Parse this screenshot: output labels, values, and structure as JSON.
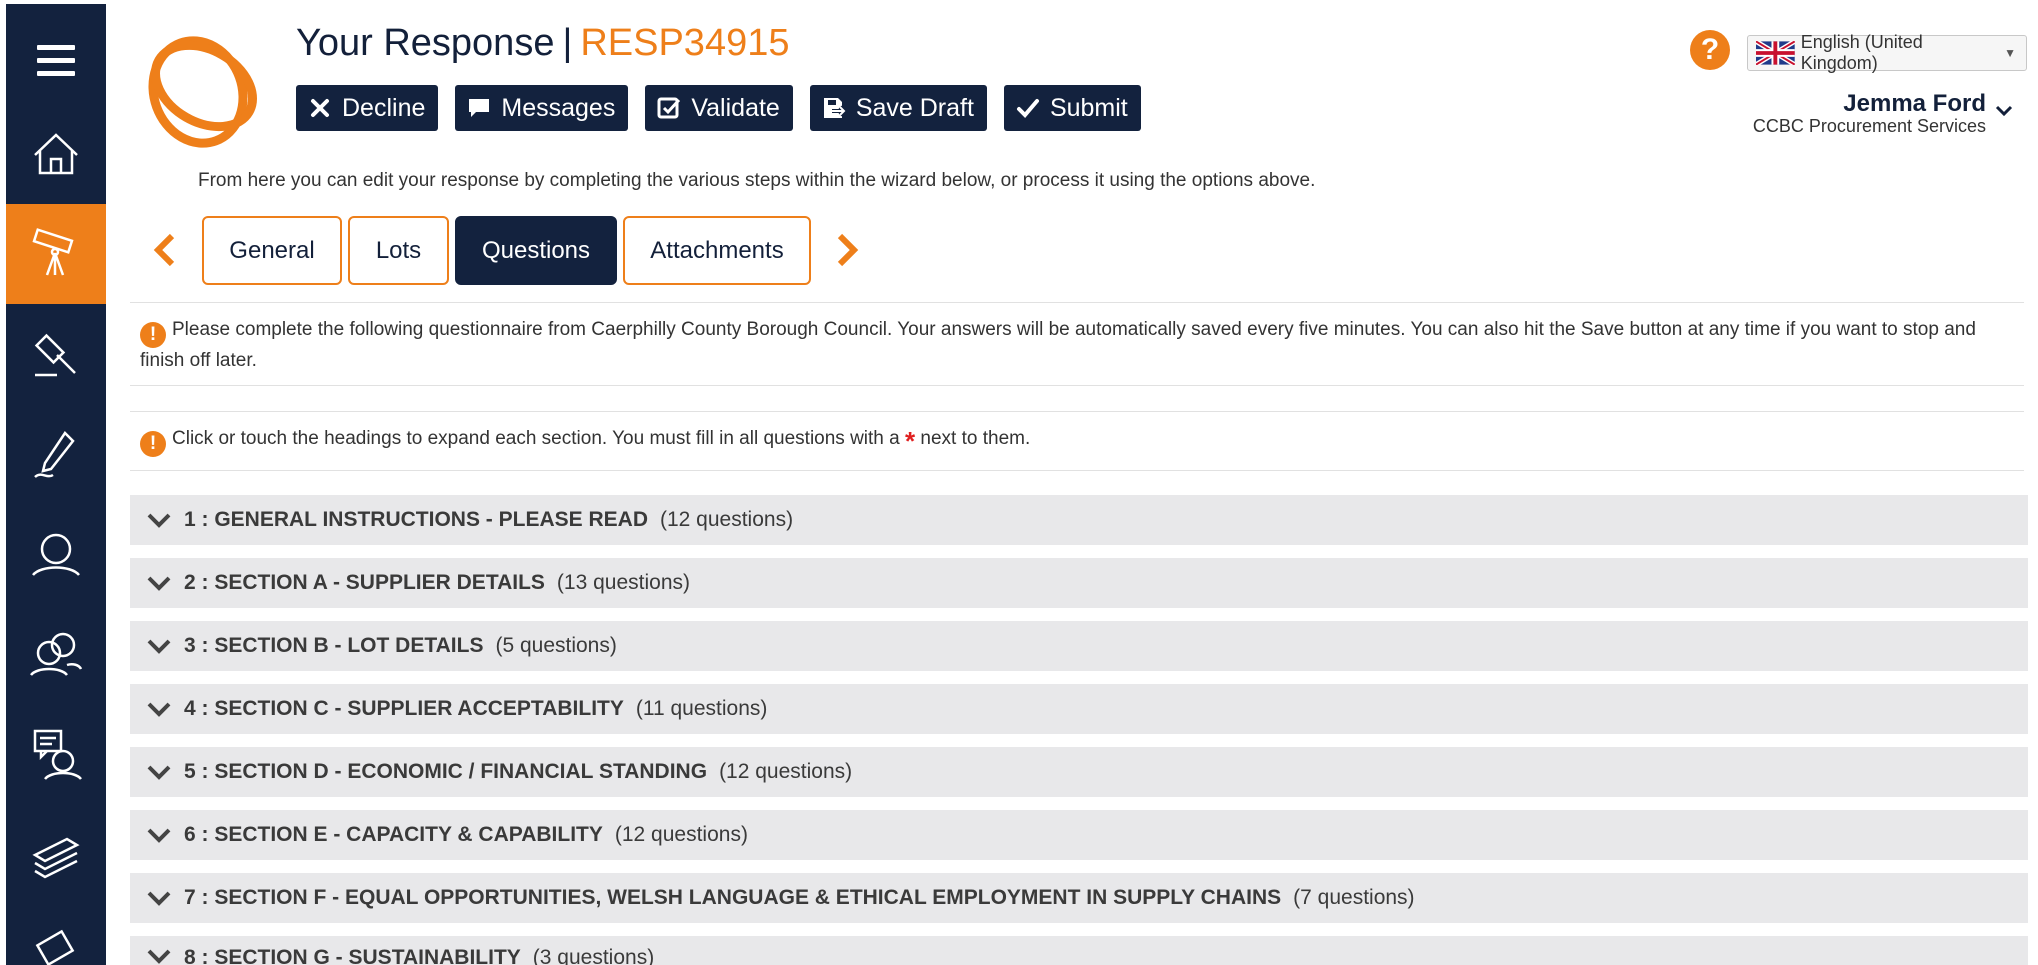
{
  "header": {
    "title_prefix": "Your Response",
    "title_separator": "|",
    "response_id": "RESP34915",
    "intro": "From here you can edit your response by completing the various steps within the wizard below, or process it using the options above."
  },
  "toolbar": {
    "decline": "Decline",
    "messages": "Messages",
    "validate": "Validate",
    "save_draft": "Save Draft",
    "submit": "Submit"
  },
  "help": {
    "label": "?"
  },
  "language": {
    "selected": "English (United Kingdom)"
  },
  "user": {
    "name": "Jemma Ford",
    "organisation": "CCBC Procurement Services"
  },
  "tabs": [
    {
      "label": "General"
    },
    {
      "label": "Lots"
    },
    {
      "label": "Questions"
    },
    {
      "label": "Attachments"
    }
  ],
  "notices": {
    "questionnaire": "Please complete the following questionnaire from Caerphilly County Borough Council. Your answers will be automatically saved every five minutes. You can also hit the Save button at any time if you want to stop and finish off later.",
    "headings_before": "Click or touch the headings to expand each section. You must fill in all questions with a",
    "headings_star": "*",
    "headings_after": "next to them."
  },
  "sections": [
    {
      "name": "1 : GENERAL INSTRUCTIONS - PLEASE READ",
      "count": "(12 questions)"
    },
    {
      "name": "2 : SECTION A - SUPPLIER DETAILS",
      "count": "(13 questions)"
    },
    {
      "name": "3 : SECTION B - LOT DETAILS",
      "count": "(5 questions)"
    },
    {
      "name": "4 : SECTION C - SUPPLIER ACCEPTABILITY",
      "count": "(11 questions)"
    },
    {
      "name": "5 : SECTION D - ECONOMIC / FINANCIAL STANDING",
      "count": "(12 questions)"
    },
    {
      "name": "6 : SECTION E - CAPACITY & CAPABILITY",
      "count": "(12 questions)"
    },
    {
      "name": "7 : SECTION F - EQUAL OPPORTUNITIES, WELSH LANGUAGE & ETHICAL EMPLOYMENT IN SUPPLY CHAINS",
      "count": "(7 questions)"
    },
    {
      "name": "8 : SECTION G - SUSTAINABILITY",
      "count": "(3 questions)"
    }
  ],
  "icons": {
    "sidebar": [
      "menu-icon",
      "home-icon",
      "telescope-icon",
      "gavel-icon",
      "pen-icon",
      "user-icon",
      "users-icon",
      "chat-user-icon",
      "layers-icon",
      "document-stack-icon"
    ],
    "accent_color": "#ee7f1a",
    "navy_color": "#13223e"
  }
}
